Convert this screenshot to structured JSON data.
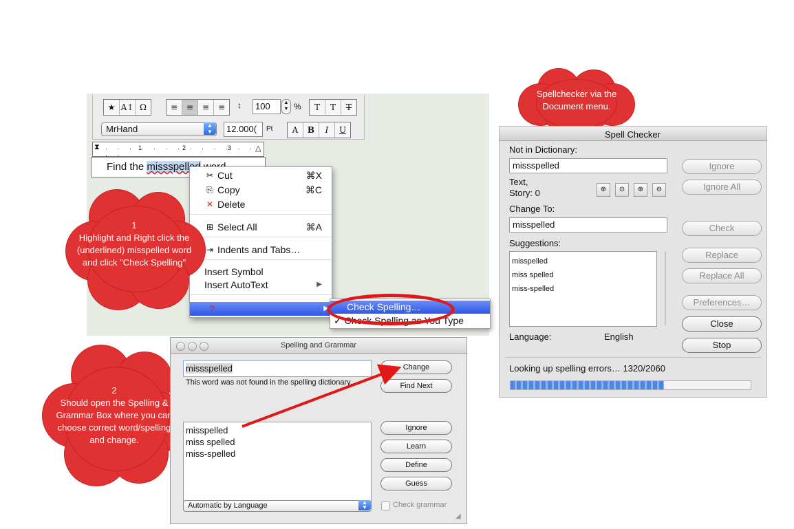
{
  "editor": {
    "toolbar": {
      "font_name": "MrHand",
      "leading_value": "100",
      "leading_unit": "%",
      "size_value": "12.000(",
      "size_unit": "Pt",
      "group1": [
        "★",
        "A↕",
        "Ω"
      ],
      "group2": [
        "≡",
        "≡",
        "≡",
        "≡"
      ],
      "group3": [
        "T",
        "T",
        "T"
      ],
      "style_buttons": [
        "A",
        "B",
        "I",
        "U"
      ]
    },
    "ruler_ticks": [
      "1",
      "2",
      "3"
    ],
    "text_before": "Find the ",
    "text_selected": "missspelled",
    "text_after": " word."
  },
  "context_menu": {
    "items": [
      {
        "icon": "✂",
        "label": "Cut",
        "shortcut": "⌘X"
      },
      {
        "icon": "⎘",
        "label": "Copy",
        "shortcut": "⌘C"
      },
      {
        "icon": "✕",
        "label": "Delete",
        "shortcut": ""
      },
      {
        "icon": "⊞",
        "label": "Select All",
        "shortcut": "⌘A"
      },
      {
        "icon": "⇥",
        "label": "Indents and Tabs…",
        "shortcut": ""
      },
      {
        "icon": "",
        "label": "Insert Symbol",
        "shortcut": ""
      },
      {
        "icon": "",
        "label": "Insert AutoText",
        "shortcut": "▶"
      }
    ],
    "highlighted_label": "?",
    "highlighted_arrow": "▶",
    "submenu": {
      "check_spelling": "Check Spelling…",
      "check_as_type": "Check Spelling as You Type",
      "checkmark": "✓"
    }
  },
  "annotations": {
    "cloud1": "1\nHighlight and Right click the (underlined) misspelled word and click \"Check Spelling\"",
    "cloud2": "2\nShould open the Spelling & Grammar Box where you can choose correct word/spelling and change.",
    "cloud3": "Spellchecker via the Document menu."
  },
  "spelling_grammar": {
    "title": "Spelling and Grammar",
    "word": "missspelled",
    "message": "This word was not found in the spelling dictionary.",
    "suggestions": [
      "misspelled",
      "miss spelled",
      "miss-spelled"
    ],
    "buttons": {
      "change": "Change",
      "find_next": "Find Next",
      "ignore": "Ignore",
      "learn": "Learn",
      "define": "Define",
      "guess": "Guess"
    },
    "language": "Automatic by Language",
    "check_grammar": "Check grammar"
  },
  "spell_checker": {
    "title": "Spell Checker",
    "not_in_dictionary_label": "Not in Dictionary:",
    "not_in_dictionary_value": "missspelled",
    "location_label": "Text,",
    "location_value": "Story: 0",
    "change_to_label": "Change To:",
    "change_to_value": "misspelled",
    "suggestions_label": "Suggestions:",
    "suggestions": [
      "misspelled",
      "miss spelled",
      "miss-spelled"
    ],
    "language_label": "Language:",
    "language_value": "English",
    "buttons": {
      "ignore": "Ignore",
      "ignore_all": "Ignore All",
      "check": "Check",
      "replace": "Replace",
      "replace_all": "Replace All",
      "preferences": "Preferences…",
      "close": "Close",
      "stop": "Stop"
    },
    "status": "Looking up spelling errors… 1320/2060",
    "progress": 0.64
  },
  "colors": {
    "cloud": "#e03232",
    "ring": "#e01818",
    "arrow": "#e01818",
    "menu_highlight": "#3a63ea"
  }
}
